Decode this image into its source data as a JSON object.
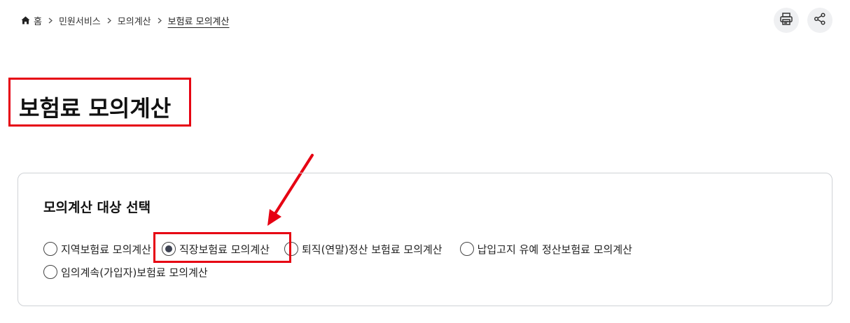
{
  "breadcrumb": {
    "home": "홈",
    "items": [
      "민원서비스",
      "모의계산",
      "보험료 모의계산"
    ]
  },
  "tools": {
    "print_icon": "printer-icon",
    "share_icon": "share-icon"
  },
  "page": {
    "title": "보험료 모의계산"
  },
  "panel": {
    "title": "모의계산 대상 선택",
    "options": [
      {
        "label": "지역보험료 모의계산",
        "checked": false
      },
      {
        "label": "직장보험료 모의계산",
        "checked": true
      },
      {
        "label": "퇴직(연말)정산 보험료 모의계산",
        "checked": false
      },
      {
        "label": "납입고지 유예 정산보험료 모의계산",
        "checked": false
      },
      {
        "label": "임의계속(가입자)보험료 모의계산",
        "checked": false
      }
    ]
  },
  "colors": {
    "annotation": "#e60012",
    "radio_dot": "#3d4252",
    "panel_border": "#cfd2d6"
  }
}
